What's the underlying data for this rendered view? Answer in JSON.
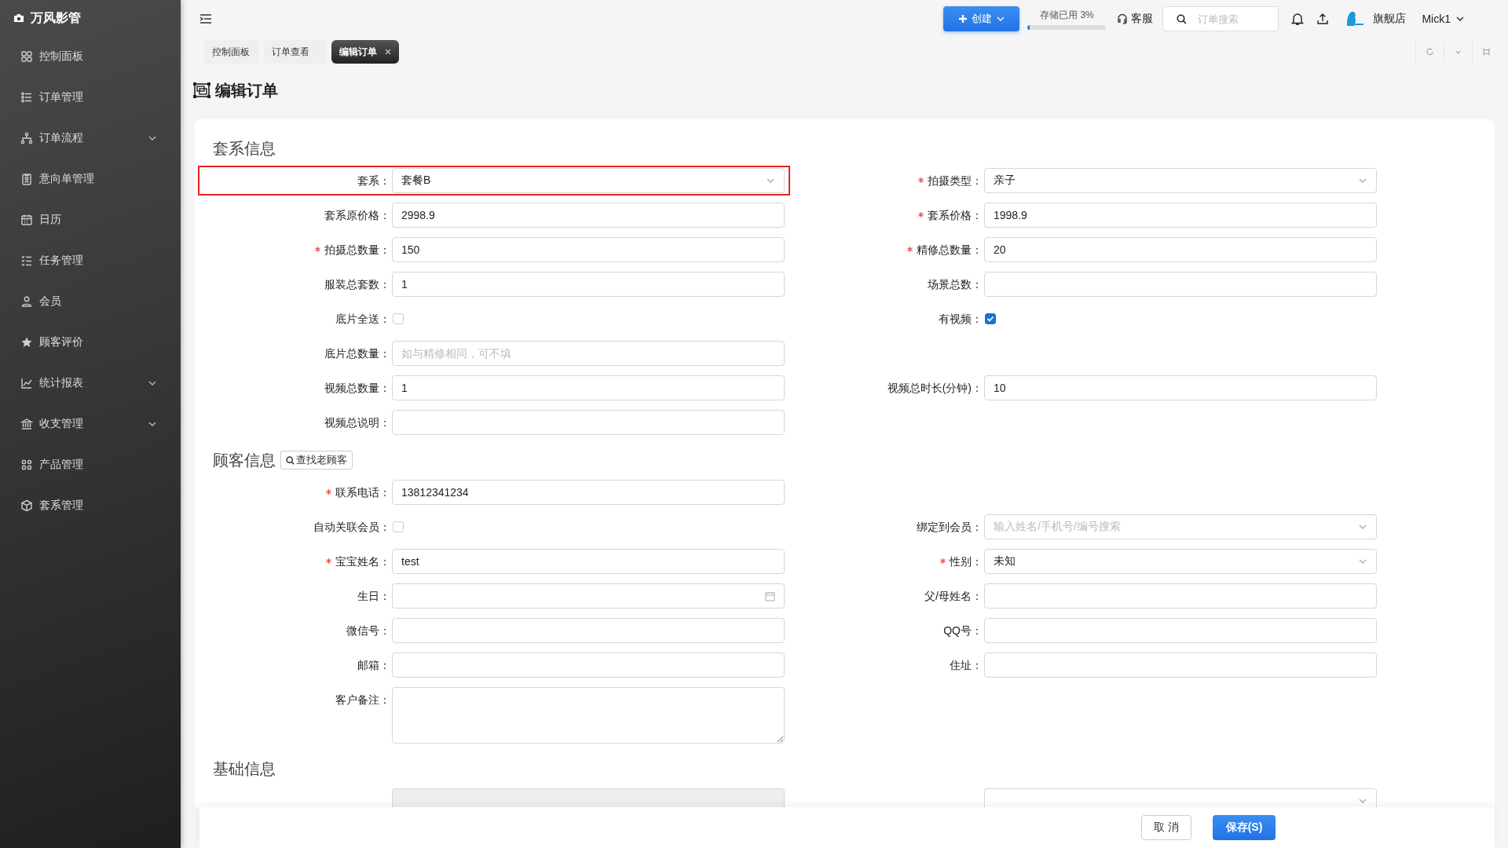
{
  "app": {
    "name": "万风影管"
  },
  "sidebar": {
    "items": [
      {
        "label": "控制面板",
        "expandable": false
      },
      {
        "label": "订单管理",
        "expandable": false
      },
      {
        "label": "订单流程",
        "expandable": true
      },
      {
        "label": "意向单管理",
        "expandable": false
      },
      {
        "label": "日历",
        "expandable": false
      },
      {
        "label": "任务管理",
        "expandable": false
      },
      {
        "label": "会员",
        "expandable": false
      },
      {
        "label": "顾客评价",
        "expandable": false
      },
      {
        "label": "统计报表",
        "expandable": true
      },
      {
        "label": "收支管理",
        "expandable": true
      },
      {
        "label": "产品管理",
        "expandable": false
      },
      {
        "label": "套系管理",
        "expandable": false
      }
    ]
  },
  "topbar": {
    "create_button": "创建",
    "storage": {
      "label": "存储已用 3%",
      "level": 0.03
    },
    "service": "客服",
    "search": {
      "placeholder": "订单搜索"
    },
    "store": "旗舰店",
    "user": "Mick1"
  },
  "tabs": [
    {
      "label": "控制面板",
      "selected": false,
      "closable": false
    },
    {
      "label": "订单查看",
      "selected": false,
      "closable": false
    },
    {
      "label": "编辑订单",
      "selected": true,
      "closable": true
    }
  ],
  "page_title": "编辑订单",
  "sections": [
    {
      "title": "套系信息",
      "rows": [
        [
          {
            "kind": "select",
            "label": "套系：",
            "required": false,
            "value": "套餐B",
            "highlighted": true
          },
          {
            "kind": "select",
            "label": "拍摄类型：",
            "required": true,
            "value": "亲子"
          }
        ],
        [
          {
            "kind": "text",
            "label": "套系原价格：",
            "required": false,
            "value": "2998.9"
          },
          {
            "kind": "text",
            "label": "套系价格：",
            "required": true,
            "value": "1998.9"
          }
        ],
        [
          {
            "kind": "text",
            "label": "拍摄总数量：",
            "required": true,
            "value": "150"
          },
          {
            "kind": "text",
            "label": "精修总数量：",
            "required": true,
            "value": "20"
          }
        ],
        [
          {
            "kind": "text",
            "label": "服装总套数：",
            "required": false,
            "value": "1"
          },
          {
            "kind": "text",
            "label": "场景总数：",
            "required": false
          }
        ],
        [
          {
            "kind": "checkbox",
            "label": "底片全送：",
            "required": false,
            "checked": false
          },
          {
            "kind": "checkbox",
            "label": "有视频：",
            "required": false,
            "checked": true
          }
        ],
        [
          {
            "kind": "text",
            "label": "底片总数量：",
            "required": false,
            "placeholder": "如与精修相同，可不填"
          },
          null
        ],
        [
          {
            "kind": "text",
            "label": "视频总数量：",
            "required": false,
            "value": "1"
          },
          {
            "kind": "text",
            "label": "视频总时长(分钟)：",
            "required": false,
            "value": "10"
          }
        ],
        [
          {
            "kind": "text",
            "label": "视频总说明：",
            "required": false
          },
          null
        ]
      ]
    },
    {
      "title": "顾客信息",
      "button": "查找老顾客",
      "rows": [
        [
          {
            "kind": "text",
            "label": "联系电话：",
            "required": true,
            "value": "13812341234"
          },
          null
        ],
        [
          {
            "kind": "checkbox",
            "label": "自动关联会员：",
            "required": false,
            "checked": false
          },
          {
            "kind": "select",
            "label": "绑定到会员：",
            "required": false,
            "placeholder": "输入姓名/手机号/编号搜索"
          }
        ],
        [
          {
            "kind": "text",
            "label": "宝宝姓名：",
            "required": true,
            "value": "test"
          },
          {
            "kind": "select",
            "label": "性别：",
            "required": true,
            "value": "未知"
          }
        ],
        [
          {
            "kind": "date",
            "label": "生日：",
            "required": false
          },
          {
            "kind": "text",
            "label": "父/母姓名：",
            "required": false
          }
        ],
        [
          {
            "kind": "text",
            "label": "微信号：",
            "required": false
          },
          {
            "kind": "text",
            "label": "QQ号：",
            "required": false
          }
        ],
        [
          {
            "kind": "text",
            "label": "邮箱：",
            "required": false
          },
          {
            "kind": "text",
            "label": "住址：",
            "required": false
          }
        ],
        [
          {
            "kind": "textarea",
            "label": "客户备注：",
            "required": false
          },
          null
        ]
      ]
    },
    {
      "title": "基础信息",
      "rows": [
        [
          {
            "kind": "text",
            "disabled": true
          },
          {
            "kind": "select"
          }
        ]
      ]
    }
  ],
  "footer": {
    "buttons": [
      {
        "label": "取 消",
        "kind": "default"
      },
      {
        "label": "保存(S)",
        "kind": "primary"
      }
    ]
  }
}
